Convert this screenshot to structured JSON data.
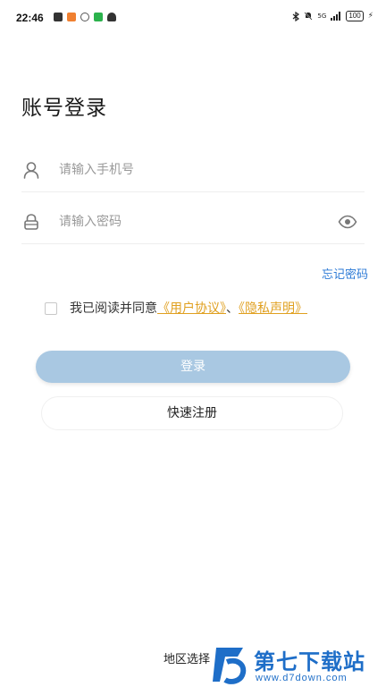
{
  "status_bar": {
    "time": "22:46",
    "signal_text": "5G",
    "battery": "100"
  },
  "title": "账号登录",
  "phone_field": {
    "placeholder": "请输入手机号",
    "value": ""
  },
  "password_field": {
    "placeholder": "请输入密码",
    "value": ""
  },
  "forgot_password": "忘记密码",
  "agreement": {
    "prefix": "我已阅读并同意",
    "user_agreement": "《用户协议》",
    "separator": "、",
    "privacy_policy": "《隐私声明》",
    "checked": false
  },
  "buttons": {
    "login": "登录",
    "register": "快速注册"
  },
  "region_select": "地区选择",
  "watermark": {
    "title": "第七下载站",
    "url": "www.d7down.com"
  },
  "colors": {
    "accent": "#2c7ad6",
    "link": "#e0a020",
    "login_button_disabled": "#a9c8e2"
  }
}
